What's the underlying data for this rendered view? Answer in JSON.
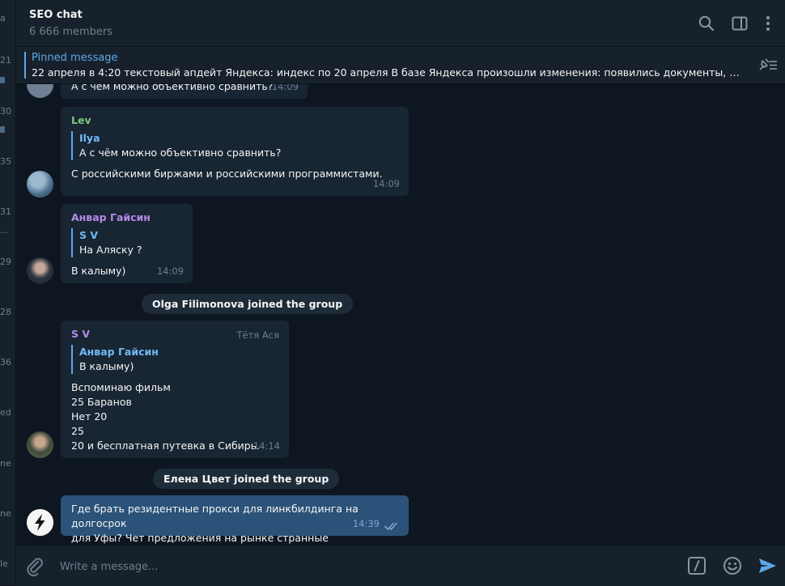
{
  "sidebar_fragments": [
    {
      "text": "a"
    },
    {
      "text": "21"
    },
    {
      "text": "30"
    },
    {
      "text": "35"
    },
    {
      "text": "31"
    },
    {
      "text": "..."
    },
    {
      "text": "29"
    },
    {
      "text": "28"
    },
    {
      "text": "36"
    },
    {
      "text": "ed"
    },
    {
      "text": "ne"
    },
    {
      "text": "ne"
    },
    {
      "text": "le"
    }
  ],
  "header": {
    "title": "SEO chat",
    "subtitle": "6 666 members",
    "icons": [
      "search-icon",
      "sidebar-toggle-icon",
      "more-vertical-icon"
    ]
  },
  "pinned": {
    "label": "Pinned message",
    "text": "22 апреля в 4:20 текстовый апдейт Яндекса: индекс по 20 апреля  В базе Яндекса произошли изменения: появились документы, проиндексированные"
  },
  "messages": [
    {
      "text": "А с чем можно объективно сравнить?",
      "time": "14:09"
    },
    {
      "sender": "Lev",
      "reply_name": "Ilya",
      "reply_text": "А с чём можно объективно сравнить?",
      "text": "С российскими биржами и российскими программистами.",
      "time": "14:09"
    },
    {
      "sender": "Анвар Гайсин",
      "reply_name": "S V",
      "reply_text": "На Аляску ?",
      "text": "В калыму)",
      "time": "14:09"
    },
    {
      "service": "Olga Filimonova joined the group"
    },
    {
      "sender": "S V",
      "admin_title": "Тётя Ася",
      "reply_name": "Анвар Гайсин",
      "reply_text": "В калыму)",
      "lines": [
        "Вспоминаю фильм",
        "25 Баранов",
        "Нет 20",
        "25",
        "20 и бесплатная путевка в Сибирь."
      ],
      "time": "14:14"
    },
    {
      "service": "Елена Цвет joined the group"
    },
    {
      "lines": [
        "Где брать резидентные прокси для линкбилдинга на долгосрок",
        "для Уфы? Чет предложения на рынке странные"
      ],
      "time": "14:39",
      "status": "read"
    }
  ],
  "composer": {
    "placeholder": "Write a message...",
    "icons": [
      "attach-icon",
      "bot-commands-icon",
      "emoji-icon",
      "send-icon"
    ]
  },
  "colors": {
    "background": "#0e1621",
    "panel": "#17212b",
    "bubble_in": "#182533",
    "bubble_out": "#2b5278",
    "accent": "#5ca8ea",
    "lev": "#7ec87e",
    "anvar": "#b48ae8",
    "sv": "#b48ae8"
  }
}
